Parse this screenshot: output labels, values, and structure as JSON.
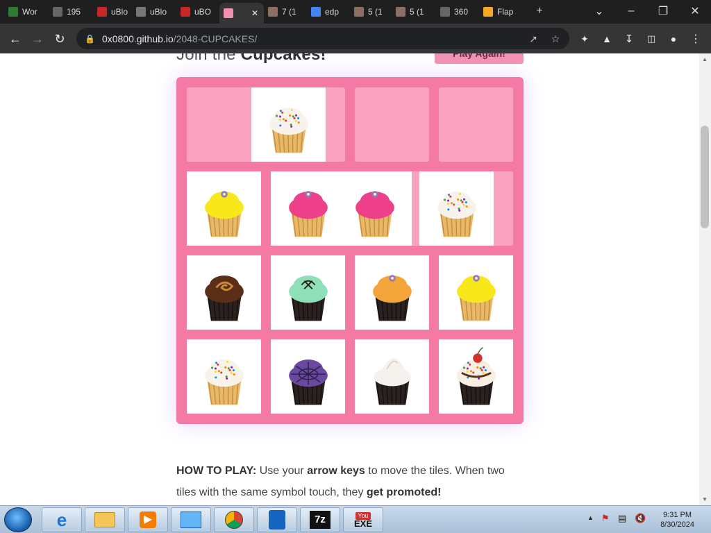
{
  "browser": {
    "tabs": [
      {
        "label": "Wor",
        "icon": "w-icon",
        "color": "#2e7d32"
      },
      {
        "label": "195",
        "icon": "globe-icon",
        "color": "#666"
      },
      {
        "label": "uBlo",
        "icon": "ublock-icon",
        "color": "#c62828"
      },
      {
        "label": "uBlo",
        "icon": "image-icon",
        "color": "#777"
      },
      {
        "label": "uBO",
        "icon": "stop-icon",
        "color": "#c62828"
      },
      {
        "label": "",
        "icon": "cupcake-favicon-icon",
        "color": "#f48fb1",
        "active": true
      },
      {
        "label": "7 (1",
        "icon": "folder-icon",
        "color": "#8d6e63"
      },
      {
        "label": "edp",
        "icon": "google-icon",
        "color": "#4285f4"
      },
      {
        "label": "5 (1",
        "icon": "folder-icon",
        "color": "#8d6e63"
      },
      {
        "label": "5 (1",
        "icon": "folder-icon",
        "color": "#8d6e63"
      },
      {
        "label": "360",
        "icon": "globe-icon",
        "color": "#666"
      },
      {
        "label": "Flap",
        "icon": "flappy-icon",
        "color": "#f9a825"
      }
    ],
    "url_domain": "0x0800.github.io",
    "url_path": "/2048-CUPCAKES/"
  },
  "page": {
    "heading_prefix": "Join the ",
    "heading_bold": "Cupcakes!",
    "play_again": "Play Again!",
    "howto": {
      "p1": "HOW TO PLAY:",
      "p2": " Use your ",
      "p3": "arrow keys",
      "p4": " to move the tiles. When two tiles with the same symbol touch, they ",
      "p5": "get promoted!"
    }
  },
  "board": {
    "tiles": [
      {
        "type": "sprinkles"
      },
      {
        "type": "yellow"
      },
      {
        "type": "pink"
      },
      {
        "type": "pink"
      },
      {
        "type": "sprinkles"
      },
      {
        "type": "choc-swirl"
      },
      {
        "type": "mint"
      },
      {
        "type": "orange"
      },
      {
        "type": "yellow"
      },
      {
        "type": "sprinkles"
      },
      {
        "type": "purple-web"
      },
      {
        "type": "meringue"
      },
      {
        "type": "sundae"
      }
    ]
  },
  "taskbar": {
    "apps": [
      "ie-icon",
      "explorer-icon",
      "media-player-icon",
      "control-panel-icon",
      "chrome-icon",
      "app-tower-icon",
      "7zip-icon",
      "youtube-exe-icon"
    ],
    "app_labels": {
      "sevenzip": "7z",
      "yt_top": "You",
      "yt_bottom": "EXE"
    },
    "time": "9:31 PM",
    "date": "8/30/2024"
  },
  "colors": {
    "board": "#f47aa5",
    "cell": "#f9a3c1",
    "play_again": "#f593b4"
  }
}
